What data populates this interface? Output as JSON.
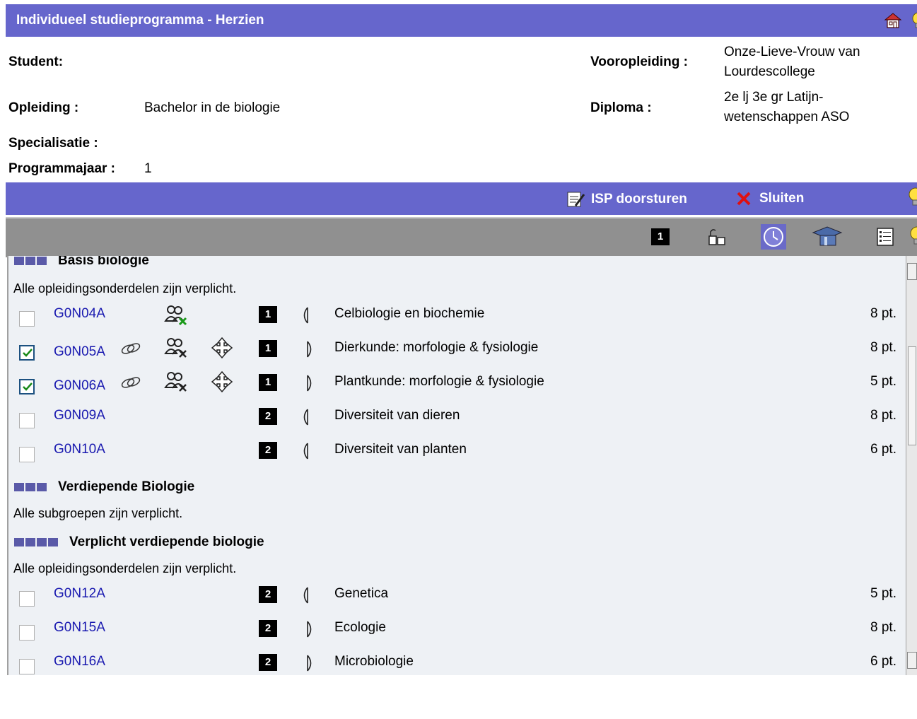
{
  "header": {
    "title": "Individueel studieprogramma  - Herzien"
  },
  "student_info": {
    "student_label": "Student:",
    "student_value": "",
    "opleiding_label": "Opleiding :",
    "opleiding_value": "Bachelor in de biologie",
    "specialisatie_label": "Specialisatie :",
    "programmajaar_label": "Programmajaar :",
    "programmajaar_value": "1",
    "vooropleiding_label": "Vooropleiding :",
    "vooropleiding_line1": "Onze-Lieve-Vrouw van",
    "vooropleiding_line2": "Lourdescollege",
    "diploma_label": "Diploma :",
    "diploma_line1": "2e lj 3e gr Latijn-",
    "diploma_line2": "wetenschappen ASO"
  },
  "actions": {
    "isp_label": "ISP doorsturen",
    "close_label": "Sluiten"
  },
  "toolbar": {
    "phase_number": "1"
  },
  "groups": {
    "basis_title": "Basis biologie",
    "basis_note": "Alle opleidingsonderdelen zijn verplicht.",
    "verdiepende_title": "Verdiepende Biologie",
    "verdiepende_note": "Alle subgroepen zijn verplicht.",
    "verplicht_title": "Verplicht verdiepende biologie",
    "verplicht_note": "Alle opleidingsonderdelen zijn verplicht."
  },
  "courses": [
    {
      "code": "G0N04A",
      "name": "Celbiologie en biochemie",
      "phase": "1",
      "points": "8 pt.",
      "checked": false,
      "semester": "first"
    },
    {
      "code": "G0N05A",
      "name": "Dierkunde: morfologie & fysiologie",
      "phase": "1",
      "points": "8 pt.",
      "checked": true,
      "semester": "second"
    },
    {
      "code": "G0N06A",
      "name": "Plantkunde: morfologie & fysiologie",
      "phase": "1",
      "points": "5 pt.",
      "checked": true,
      "semester": "second"
    },
    {
      "code": "G0N09A",
      "name": "Diversiteit van dieren",
      "phase": "2",
      "points": "8 pt.",
      "checked": false,
      "semester": "first"
    },
    {
      "code": "G0N10A",
      "name": "Diversiteit van planten",
      "phase": "2",
      "points": "6 pt.",
      "checked": false,
      "semester": "first"
    },
    {
      "code": "G0N12A",
      "name": "Genetica",
      "phase": "2",
      "points": "5 pt.",
      "checked": false,
      "semester": "first"
    },
    {
      "code": "G0N15A",
      "name": "Ecologie",
      "phase": "2",
      "points": "8 pt.",
      "checked": false,
      "semester": "second"
    },
    {
      "code": "G0N16A",
      "name": "Microbiologie",
      "phase": "2",
      "points": "6 pt.",
      "checked": false,
      "semester": "second"
    }
  ],
  "colors": {
    "header_bar": "#6666cc",
    "toolbar_bar": "#909090",
    "content_bg": "#eef1f5",
    "link": "#1a1ab0"
  }
}
